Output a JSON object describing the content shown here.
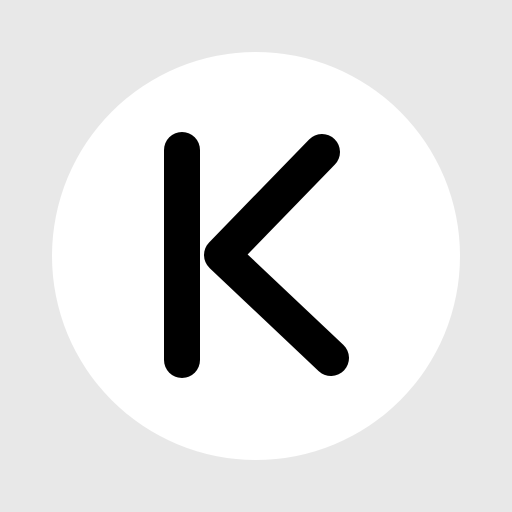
{
  "icon": {
    "name": "k-letter-icon",
    "letter": "K",
    "background_color": "#e8e8e8",
    "circle_color": "#ffffff",
    "stroke_color": "#000000"
  }
}
